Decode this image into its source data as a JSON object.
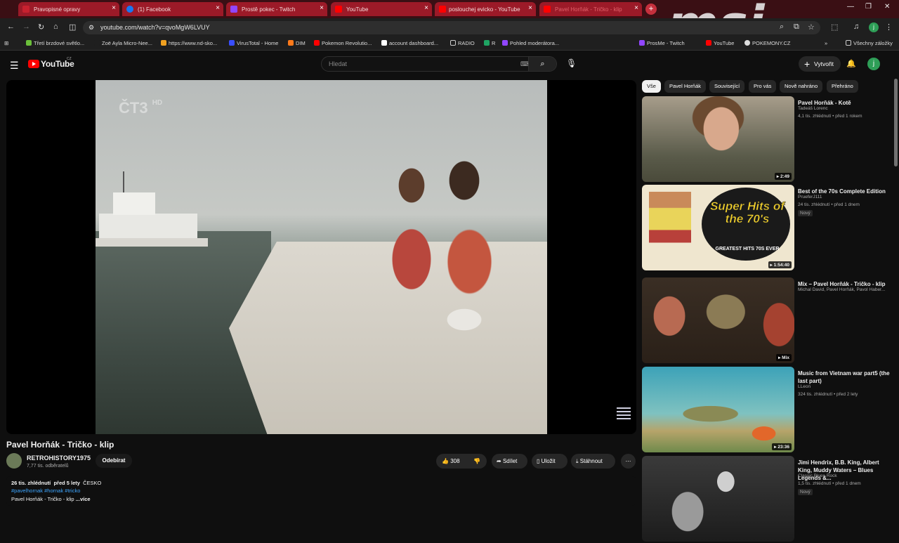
{
  "tabs": [
    {
      "title": "Pravopisné opravy",
      "favicon": "red"
    },
    {
      "title": "(1) Facebook",
      "favicon": "facebook"
    },
    {
      "title": "Prostě pokec - Twitch",
      "favicon": "twitch"
    },
    {
      "title": "YouTube",
      "favicon": "youtube"
    },
    {
      "title": "poslouchej evicko - YouTube",
      "favicon": "youtube"
    },
    {
      "title": "Pavel Horňák - Tričko - klip",
      "favicon": "youtube"
    }
  ],
  "url": "youtube.com/watch?v=qvoMgW6LVUY",
  "bookmarks": [
    "Třetí brzdové světlo...",
    "Zoë Ayla Micro-Nee...",
    "https://www.nd-sko...",
    "VirusTotal - Home",
    "DIM",
    "Pokemon Revolutio...",
    "account dashboard...",
    "RADIO",
    "R",
    "Pohled moderátora...",
    "ProsMe - Twitch",
    "YouTube",
    "POKEMONY.CZ"
  ],
  "all_bookmarks": "Všechny záložky",
  "youtube": {
    "logo": "YouTube",
    "region": "CZ",
    "search_placeholder": "Hledat",
    "create": "Vytvořit",
    "avatar": "j"
  },
  "video": {
    "title": "Pavel Horňák - Tričko - klip",
    "watermark": "ČT3",
    "watermark_sub": "HD",
    "channel": "RETROHISTORY1975",
    "subscribers": "7,77 tis. odběratelů",
    "subscribe": "Odebírat",
    "likes": "308",
    "share": "Sdílet",
    "save": "Uložit",
    "download": "Stáhnout",
    "more": "⋯",
    "views": "26 tis. zhlédnutí",
    "age": "před 5 lety",
    "country": "ČESKO",
    "tags": "#pavelhornak #hornak #tricko",
    "desc_line": "Pavel Horňák - Tričko - klip",
    "desc_more": "...více"
  },
  "chips": [
    "Vše",
    "Pavel Horňák",
    "Související",
    "Pro vás",
    "Nově nahráno",
    "Přehráno"
  ],
  "recommendations": [
    {
      "title": "Pavel Horňák - Kotě",
      "channel": "Tadeáš Lorenc",
      "meta": "4,1 tis. zhlédnutí • před 1 rokem",
      "duration": "2:49",
      "badge": ""
    },
    {
      "title": "Best of the 70s Complete Edition",
      "channel": "PrueferJ111",
      "meta": "24 tis. zhlédnutí • před 1 dnem",
      "duration": "1:54:40",
      "badge": "Nový",
      "thumb_text": "Super Hits of the 70's",
      "thumb_sub": "GREATEST HITS 70S EVER"
    },
    {
      "title": "Mix – Pavel Horňák - Tričko - klip",
      "channel": "Michal David, Pavel Horňák, Pavol Haber...",
      "meta": "",
      "duration": "Mix",
      "badge": ""
    },
    {
      "title": "Music from Vietnam war part5 (the last part)",
      "channel": "LLeon",
      "meta": "324 tis. zhlédnutí • před 2 lety",
      "duration": "23:36",
      "badge": ""
    },
    {
      "title": "Jimi Hendrix, B.B. King, Albert King, Muddy Waters – Blues Legends &...",
      "channel": "Classic Blues Rock",
      "meta": "1,5 tis. zhlédnutí • před 1 dnem",
      "duration": "",
      "badge": "Nový"
    }
  ]
}
